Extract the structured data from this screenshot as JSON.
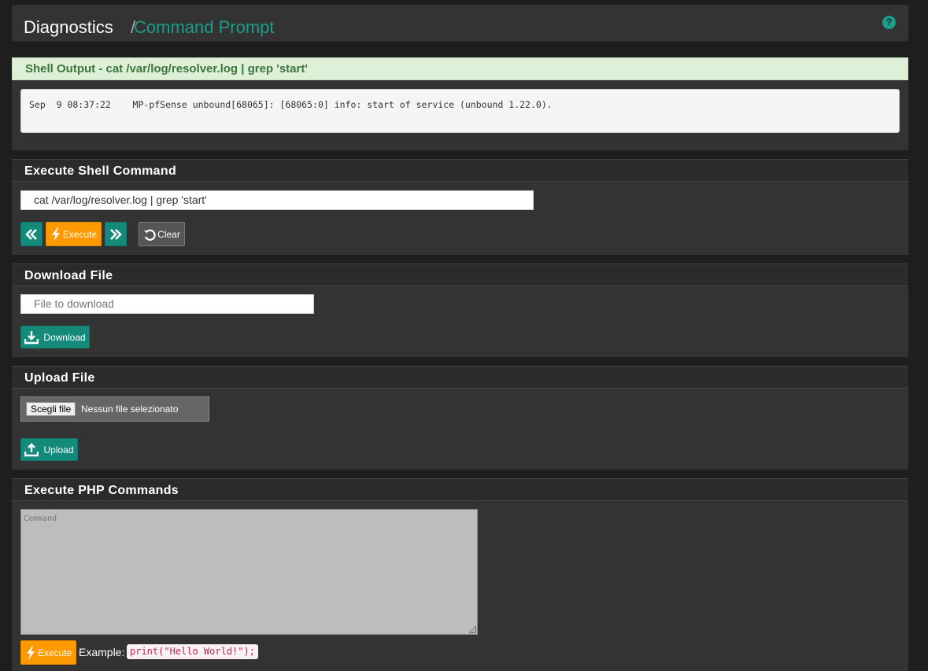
{
  "header": {
    "crumb_parent": "Diagnostics",
    "separator": "/",
    "crumb_current": "Command Prompt",
    "help_glyph": "?"
  },
  "shell_output": {
    "title": "Shell Output - cat /var/log/resolver.log | grep 'start'",
    "output": "Sep  9 08:37:22    MP-pfSense unbound[68065]: [68065:0] info: start of service (unbound 1.22.0)."
  },
  "execute_shell": {
    "title": "Execute Shell Command",
    "command_value": "cat /var/log/resolver.log | grep 'start'",
    "history_back_icon": "double-chevron-left-icon",
    "execute_label": "Execute",
    "history_forward_icon": "double-chevron-right-icon",
    "clear_label": "Clear"
  },
  "download_file": {
    "title": "Download File",
    "placeholder": "File to download",
    "button_label": "Download"
  },
  "upload_file": {
    "title": "Upload File",
    "choose_label": "Scegli file",
    "status": "Nessun file selezionato",
    "button_label": "Upload"
  },
  "execute_php": {
    "title": "Execute PHP Commands",
    "placeholder": "Command",
    "execute_label": "Execute",
    "example_label": "Example:",
    "example_code": "print(\"Hello World!\");"
  },
  "colors": {
    "accent": "#1a9e8a",
    "button_teal": "#138a7a",
    "button_orange": "#ff9900",
    "success_bg": "#dff0d8",
    "success_text": "#3c763d"
  }
}
